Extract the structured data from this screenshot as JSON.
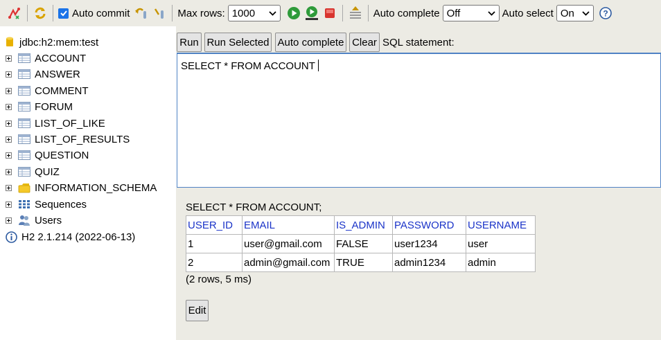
{
  "toolbar": {
    "auto_commit_label": "Auto commit",
    "auto_commit_checked": true,
    "max_rows_label": "Max rows:",
    "max_rows_value": "1000",
    "auto_complete_label": "Auto complete",
    "auto_complete_value": "Off",
    "auto_select_label": "Auto select",
    "auto_select_value": "On"
  },
  "tree": {
    "connection": "jdbc:h2:mem:test",
    "tables": [
      "ACCOUNT",
      "ANSWER",
      "COMMENT",
      "FORUM",
      "LIST_OF_LIKE",
      "LIST_OF_RESULTS",
      "QUESTION",
      "QUIZ"
    ],
    "schema": "INFORMATION_SCHEMA",
    "sequences": "Sequences",
    "users": "Users",
    "version": "H2 2.1.214 (2022-06-13)"
  },
  "buttons": {
    "run": "Run",
    "run_selected": "Run Selected",
    "auto_complete": "Auto complete",
    "clear": "Clear",
    "sql_statement": "SQL statement:"
  },
  "editor": {
    "text": "SELECT * FROM ACCOUNT"
  },
  "results": {
    "query": "SELECT * FROM ACCOUNT;",
    "columns": [
      "USER_ID",
      "EMAIL",
      "IS_ADMIN",
      "PASSWORD",
      "USERNAME"
    ],
    "rows": [
      [
        "1",
        "user@gmail.com",
        "FALSE",
        "user1234",
        "user"
      ],
      [
        "2",
        "admin@gmail.com",
        "TRUE",
        "admin1234",
        "admin"
      ]
    ],
    "count": "(2 rows, 5 ms)",
    "edit": "Edit"
  },
  "colors": {
    "accent": "#1a73e8",
    "header_link": "#1a33c8",
    "panel_bg": "#ecebe4"
  }
}
